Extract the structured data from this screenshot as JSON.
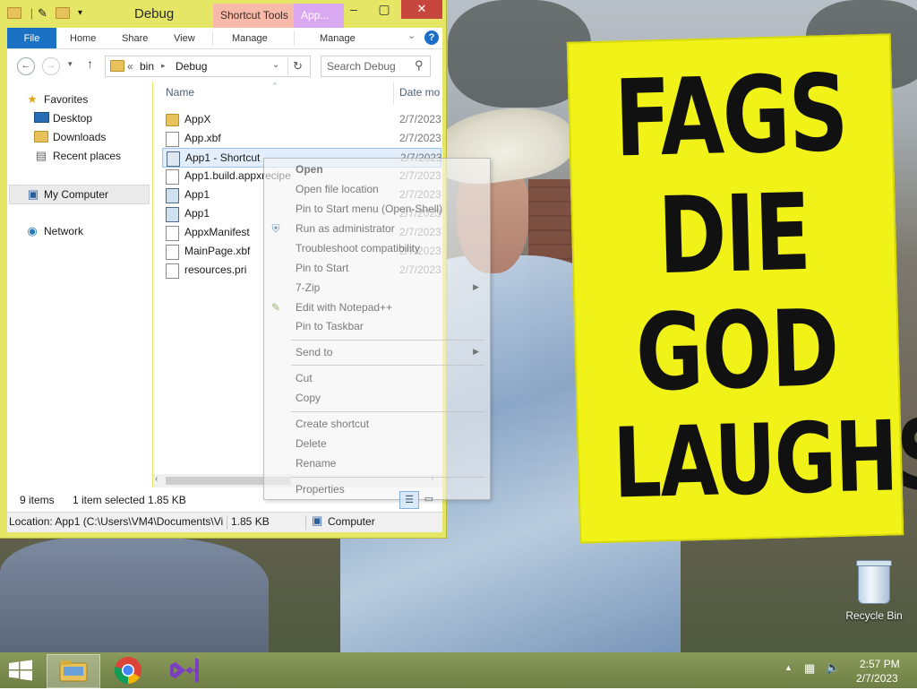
{
  "window": {
    "title": "Debug",
    "context_tabs": [
      "Shortcut Tools",
      "App..."
    ],
    "ribbon_tabs": [
      "File",
      "Home",
      "Share",
      "View",
      "Manage",
      "Manage"
    ],
    "close_glyph": "✕"
  },
  "address": {
    "overflow": "«",
    "crumbs": [
      "bin",
      "Debug"
    ],
    "search_placeholder": "Search Debug"
  },
  "nav": {
    "favorites": "Favorites",
    "items": [
      "Desktop",
      "Downloads",
      "Recent places"
    ],
    "my_computer": "My Computer",
    "network": "Network"
  },
  "columns": {
    "name": "Name",
    "date": "Date mo"
  },
  "files": [
    {
      "name": "AppX",
      "date": "2/7/2023",
      "type": "folder"
    },
    {
      "name": "App.xbf",
      "date": "2/7/2023",
      "type": "doc"
    },
    {
      "name": "App1 - Shortcut",
      "date": "2/7/2023",
      "type": "shortcut",
      "selected": true
    },
    {
      "name": "App1.build.appxrecipe",
      "date": "2/7/2023",
      "type": "doc"
    },
    {
      "name": "App1",
      "date": "2/7/2023",
      "type": "app"
    },
    {
      "name": "App1",
      "date": "2/7/2023",
      "type": "app"
    },
    {
      "name": "AppxManifest",
      "date": "2/7/2023",
      "type": "doc"
    },
    {
      "name": "MainPage.xbf",
      "date": "2/7/2023",
      "type": "doc"
    },
    {
      "name": "resources.pri",
      "date": "2/7/2023",
      "type": "doc"
    }
  ],
  "status": {
    "count": "9 items",
    "selection": "1 item selected  1.85 KB",
    "location": "Location: App1 (C:\\Users\\VM4\\Documents\\Vi",
    "size": "1.85 KB",
    "computer": "Computer"
  },
  "context_menu": {
    "items": [
      "Open",
      "Open file location",
      "Pin to Start menu (Open-Shell)",
      "Run as administrator",
      "Troubleshoot compatibility",
      "Pin to Start",
      "7-Zip",
      "Edit with Notepad++",
      "Pin to Taskbar",
      "Send to",
      "Cut",
      "Copy",
      "Create shortcut",
      "Delete",
      "Rename",
      "Properties"
    ]
  },
  "wallpaper_sign": [
    "FAGS",
    "DIE",
    "GOD",
    "LAUGHS"
  ],
  "desktop": {
    "recycle_bin": "Recycle Bin"
  },
  "clock": {
    "time": "2:57 PM",
    "date": "2/7/2023"
  },
  "colors": {
    "accent": "#1b72c4",
    "frame": "#e5e566",
    "close": "#c7473f",
    "taskbar": "#7a8a50",
    "sign": "#f1f218"
  }
}
